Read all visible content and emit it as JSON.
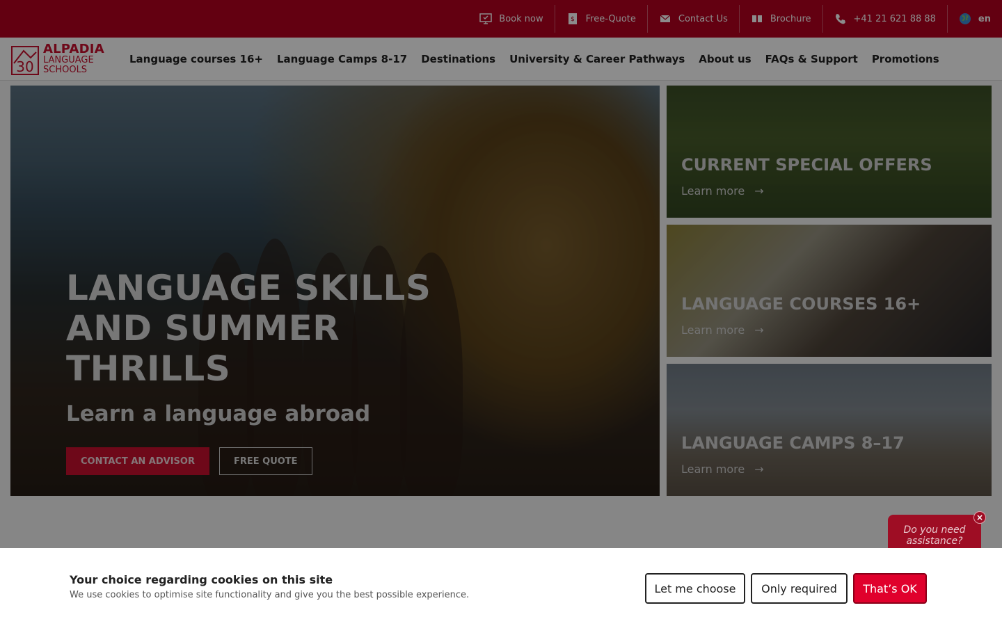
{
  "topbar": {
    "items": [
      {
        "label": "Book now",
        "icon": "monitor-icon"
      },
      {
        "label": "Free-Quote",
        "icon": "document-dollar-icon"
      },
      {
        "label": "Contact Us",
        "icon": "envelope-icon"
      },
      {
        "label": "Brochure",
        "icon": "book-icon"
      },
      {
        "label": "+41 21 621 88 88",
        "icon": "phone-icon"
      },
      {
        "label": "en",
        "icon": "globe-icon"
      }
    ]
  },
  "logo": {
    "number": "30",
    "brand": "ALPADIA",
    "line1": "LANGUAGE",
    "line2": "SCHOOLS"
  },
  "nav": {
    "items": [
      "Language courses 16+",
      "Language Camps 8-17",
      "Destinations",
      "University & Career Pathways",
      "About us",
      "FAQs & Support",
      "Promotions"
    ]
  },
  "hero": {
    "title": "LANGUAGE SKILLS AND SUMMER THRILLS",
    "subtitle": "Learn a language abroad",
    "primary_button": "CONTACT AN ADVISOR",
    "secondary_button": "FREE QUOTE"
  },
  "cards": [
    {
      "title": "CURRENT SPECIAL OFFERS",
      "link": "Learn more",
      "arrow": "→"
    },
    {
      "title": "LANGUAGE COURSES 16+",
      "link": "Learn more",
      "arrow": "→"
    },
    {
      "title": "LANGUAGE CAMPS 8–17",
      "link": "Learn more",
      "arrow": "→"
    }
  ],
  "chat": {
    "text": "Do you need assistance?",
    "close": "×"
  },
  "cookie": {
    "title": "Your choice regarding cookies on this site",
    "description": "We use cookies to optimise site functionality and give you the best possible experience.",
    "buttons": {
      "choose": "Let me choose",
      "required": "Only required",
      "ok": "That’s OK"
    }
  },
  "colors": {
    "brand_red": "#b5001f",
    "accent_red": "#c8102e",
    "ok_button": "#e0002c"
  }
}
